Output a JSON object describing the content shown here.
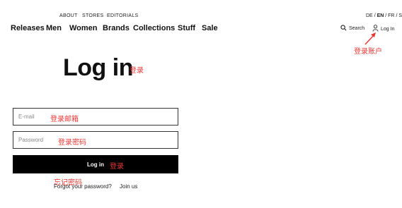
{
  "header": {
    "top_links": [
      "ABOUT",
      "STORES",
      "EDITORIALS"
    ],
    "languages": [
      "DE",
      "EN",
      "FR",
      "S"
    ],
    "active_language": "EN",
    "nav": [
      "Releases",
      "Men",
      "Women",
      "Brands",
      "Collections",
      "Stuff",
      "Sale"
    ],
    "search_label": "Search",
    "login_label": "Log In"
  },
  "main": {
    "title": "Log in",
    "email_placeholder": "E-mail",
    "password_placeholder": "Password",
    "submit_label": "Log in",
    "forgot_link": "Forgot your password?",
    "join_link": "Join us"
  },
  "annotations": {
    "title_note": "登录",
    "account_note": "登录账户",
    "email_note": "登录邮箱",
    "password_note": "登录密码",
    "button_note": "登录",
    "forgot_note": "忘记密码"
  },
  "colors": {
    "annotation": "#e53935",
    "button_bg": "#000000",
    "text": "#111111"
  }
}
